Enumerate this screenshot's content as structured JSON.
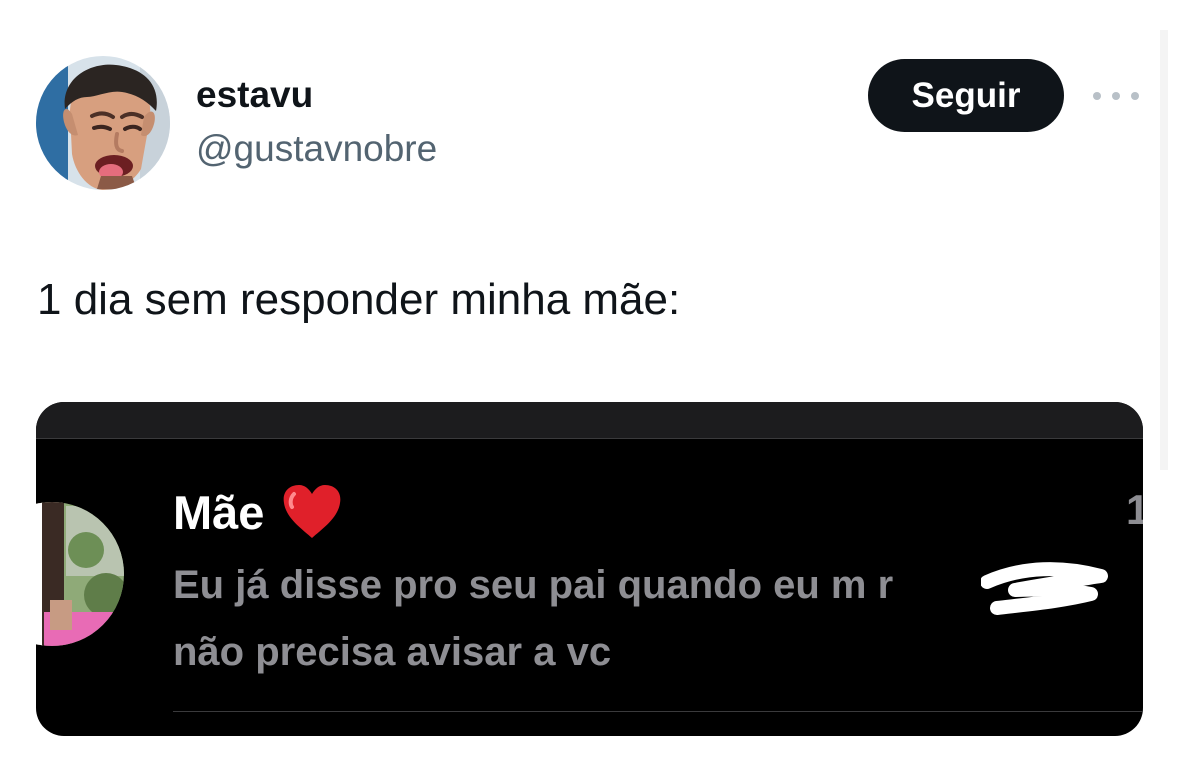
{
  "author": {
    "display_name": "estavu",
    "handle": "@gustavnobre"
  },
  "actions": {
    "follow_label": "Seguir",
    "more_icon": "more-horizontal-icon"
  },
  "tweet": {
    "text": "1 dia sem responder minha mãe:"
  },
  "media": {
    "contact_name": "Mãe",
    "contact_emoji": "heart-icon",
    "time_fragment": "1",
    "message_line_1": "Eu já disse pro seu pai quando eu m    r",
    "message_line_2": "não precisa avisar a vc"
  },
  "colors": {
    "text_primary": "#0f1419",
    "text_secondary": "#536471",
    "button_bg": "#0f1419",
    "media_bg": "#000000",
    "message_gray": "#8e8e93",
    "heart": "#e0202a"
  }
}
